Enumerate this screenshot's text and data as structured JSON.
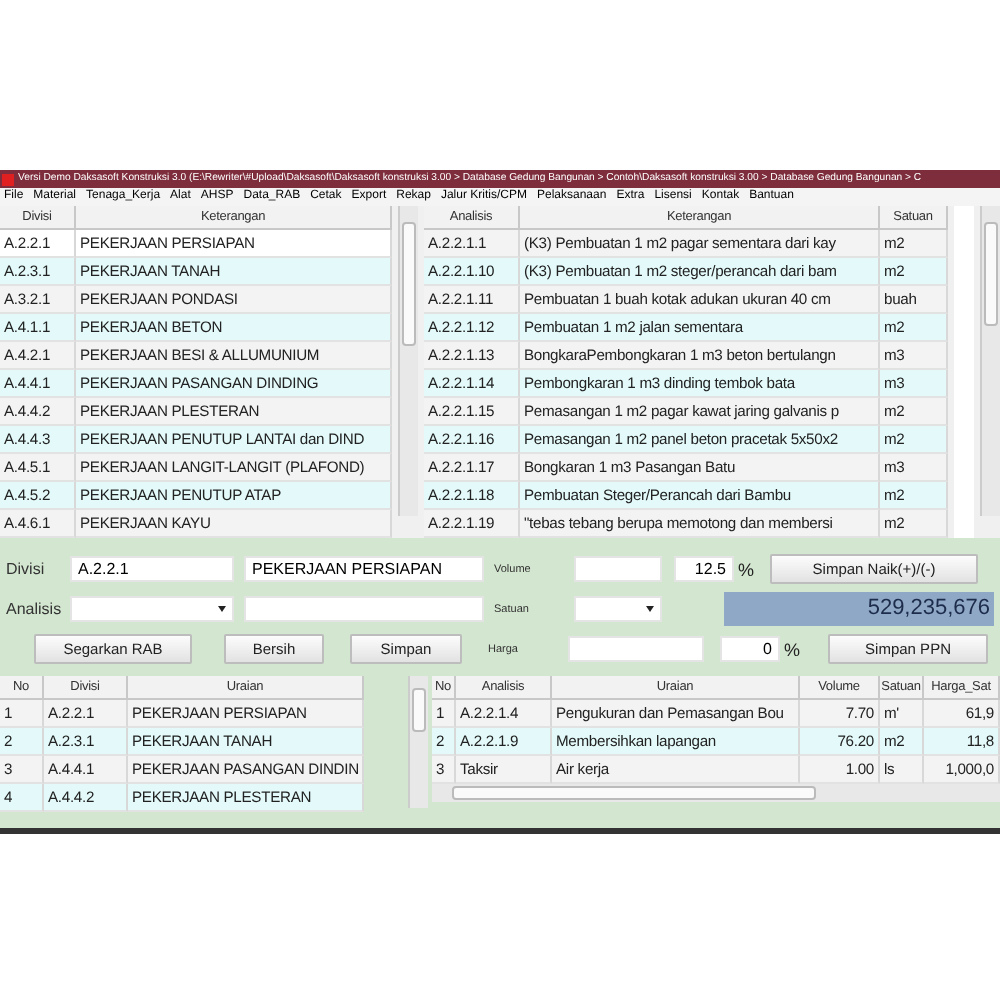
{
  "window": {
    "title": "Versi Demo Daksasoft Konstruksi 3.0 (E:\\Rewriter\\#Upload\\Daksasoft\\Daksasoft konstruksi 3.00 > Database Gedung Bangunan > Contoh\\Daksasoft konstruksi 3.00 > Database Gedung Bangunan > C"
  },
  "menu": [
    "File",
    "Material",
    "Tenaga_Kerja",
    "Alat",
    "AHSP",
    "Data_RAB",
    "Cetak",
    "Export",
    "Rekap",
    "Jalur Kritis/CPM",
    "Pelaksanaan",
    "Extra",
    "Lisensi",
    "Kontak",
    "Bantuan"
  ],
  "divisi_table": {
    "columns": [
      "Divisi",
      "Keterangan"
    ],
    "rows": [
      {
        "cells": [
          "A.2.2.1",
          "PEKERJAAN PERSIAPAN"
        ],
        "selected": true
      },
      {
        "cells": [
          "A.2.3.1",
          "PEKERJAAN TANAH"
        ],
        "selected": false
      },
      {
        "cells": [
          "A.3.2.1",
          "PEKERJAAN PONDASI"
        ],
        "selected": false
      },
      {
        "cells": [
          "A.4.1.1",
          "PEKERJAAN BETON"
        ],
        "selected": false
      },
      {
        "cells": [
          "A.4.2.1",
          "PEKERJAAN BESI & ALLUMUNIUM"
        ],
        "selected": false
      },
      {
        "cells": [
          "A.4.4.1",
          "PEKERJAAN PASANGAN DINDING"
        ],
        "selected": false
      },
      {
        "cells": [
          "A.4.4.2",
          "PEKERJAAN PLESTERAN"
        ],
        "selected": false
      },
      {
        "cells": [
          "A.4.4.3",
          "PEKERJAAN PENUTUP LANTAI dan DIND"
        ],
        "selected": false
      },
      {
        "cells": [
          "A.4.5.1",
          "PEKERJAAN LANGIT-LANGIT (PLAFOND)"
        ],
        "selected": false
      },
      {
        "cells": [
          "A.4.5.2",
          "PEKERJAAN PENUTUP ATAP"
        ],
        "selected": false
      },
      {
        "cells": [
          "A.4.6.1",
          "PEKERJAAN  KAYU"
        ],
        "selected": false
      }
    ]
  },
  "analisis_table": {
    "columns": [
      "Analisis",
      "Keterangan",
      "Satuan"
    ],
    "rows": [
      {
        "cells": [
          "A.2.2.1.1",
          "(K3) Pembuatan 1 m2 pagar sementara dari kay",
          "m2"
        ],
        "selected": false
      },
      {
        "cells": [
          "A.2.2.1.10",
          "(K3) Pembuatan 1 m2 steger/perancah dari bam",
          "m2"
        ],
        "selected": false
      },
      {
        "cells": [
          "A.2.2.1.11",
          "Pembuatan 1 buah kotak adukan ukuran 40 cm",
          "buah"
        ],
        "selected": false
      },
      {
        "cells": [
          "A.2.2.1.12",
          "Pembuatan 1 m2 jalan sementara",
          "m2"
        ],
        "selected": false
      },
      {
        "cells": [
          "A.2.2.1.13",
          "BongkaraPembongkaran 1 m3 beton bertulangn",
          "m3"
        ],
        "selected": false
      },
      {
        "cells": [
          "A.2.2.1.14",
          "Pembongkaran 1 m3 dinding tembok bata",
          "m3"
        ],
        "selected": false
      },
      {
        "cells": [
          "A.2.2.1.15",
          "Pemasangan 1 m2 pagar kawat jaring galvanis p",
          "m2"
        ],
        "selected": false
      },
      {
        "cells": [
          "A.2.2.1.16",
          "Pemasangan 1 m2 panel beton pracetak 5x50x2",
          "m2"
        ],
        "selected": false
      },
      {
        "cells": [
          "A.2.2.1.17",
          "Bongkaran 1 m3 Pasangan Batu",
          "m3"
        ],
        "selected": false
      },
      {
        "cells": [
          "A.2.2.1.18",
          "Pembuatan Steger/Perancah  dari Bambu",
          "m2"
        ],
        "selected": false
      },
      {
        "cells": [
          "A.2.2.1.19",
          "\"tebas tebang berupa memotong dan membersi",
          "m2"
        ],
        "selected": false
      }
    ]
  },
  "form": {
    "divisi": {
      "label": "Divisi",
      "code": "A.2.2.1",
      "name": "PEKERJAAN PERSIAPAN"
    },
    "analisis": {
      "label": "Analisis"
    },
    "volume": {
      "label": "Volume",
      "percent": "12.5",
      "percent_sign": "%"
    },
    "satuan": {
      "label": "Satuan"
    },
    "harga": {
      "label": "Harga",
      "percent": "0",
      "percent_sign": "%"
    },
    "total": "529,235,676",
    "buttons": [
      "Segarkan RAB",
      "Bersih",
      "Simpan"
    ],
    "save_raise_button": "Simpan Naik(+)/(-)",
    "save_ppn_button": "Simpan PPN"
  },
  "rab_table": {
    "columns": [
      "No",
      "Divisi",
      "Uraian"
    ],
    "rows": [
      {
        "cells": [
          "1",
          "A.2.2.1",
          "PEKERJAAN PERSIAPAN"
        ],
        "selected": false
      },
      {
        "cells": [
          "2",
          "A.2.3.1",
          "PEKERJAAN TANAH"
        ],
        "selected": false
      },
      {
        "cells": [
          "3",
          "A.4.4.1",
          "PEKERJAAN PASANGAN DINDIN"
        ],
        "selected": false
      },
      {
        "cells": [
          "4",
          "A.4.4.2",
          "PEKERJAAN PLESTERAN"
        ],
        "selected": false
      }
    ]
  },
  "detail_table": {
    "columns": [
      "No",
      "Analisis",
      "Uraian",
      "Volume",
      "Satuan",
      "Harga_Sat"
    ],
    "rows": [
      {
        "cells": [
          "1",
          "A.2.2.1.4",
          "Pengukuran dan Pemasangan Bou",
          "7.70",
          "m'",
          "61,9"
        ],
        "selected": false
      },
      {
        "cells": [
          "2",
          "A.2.2.1.9",
          "Membersihkan lapangan",
          "76.20",
          "m2",
          "11,8"
        ],
        "selected": false
      },
      {
        "cells": [
          "3",
          "Taksir",
          "Air kerja",
          "1.00",
          "ls",
          "1,000,0"
        ],
        "selected": false
      }
    ]
  }
}
